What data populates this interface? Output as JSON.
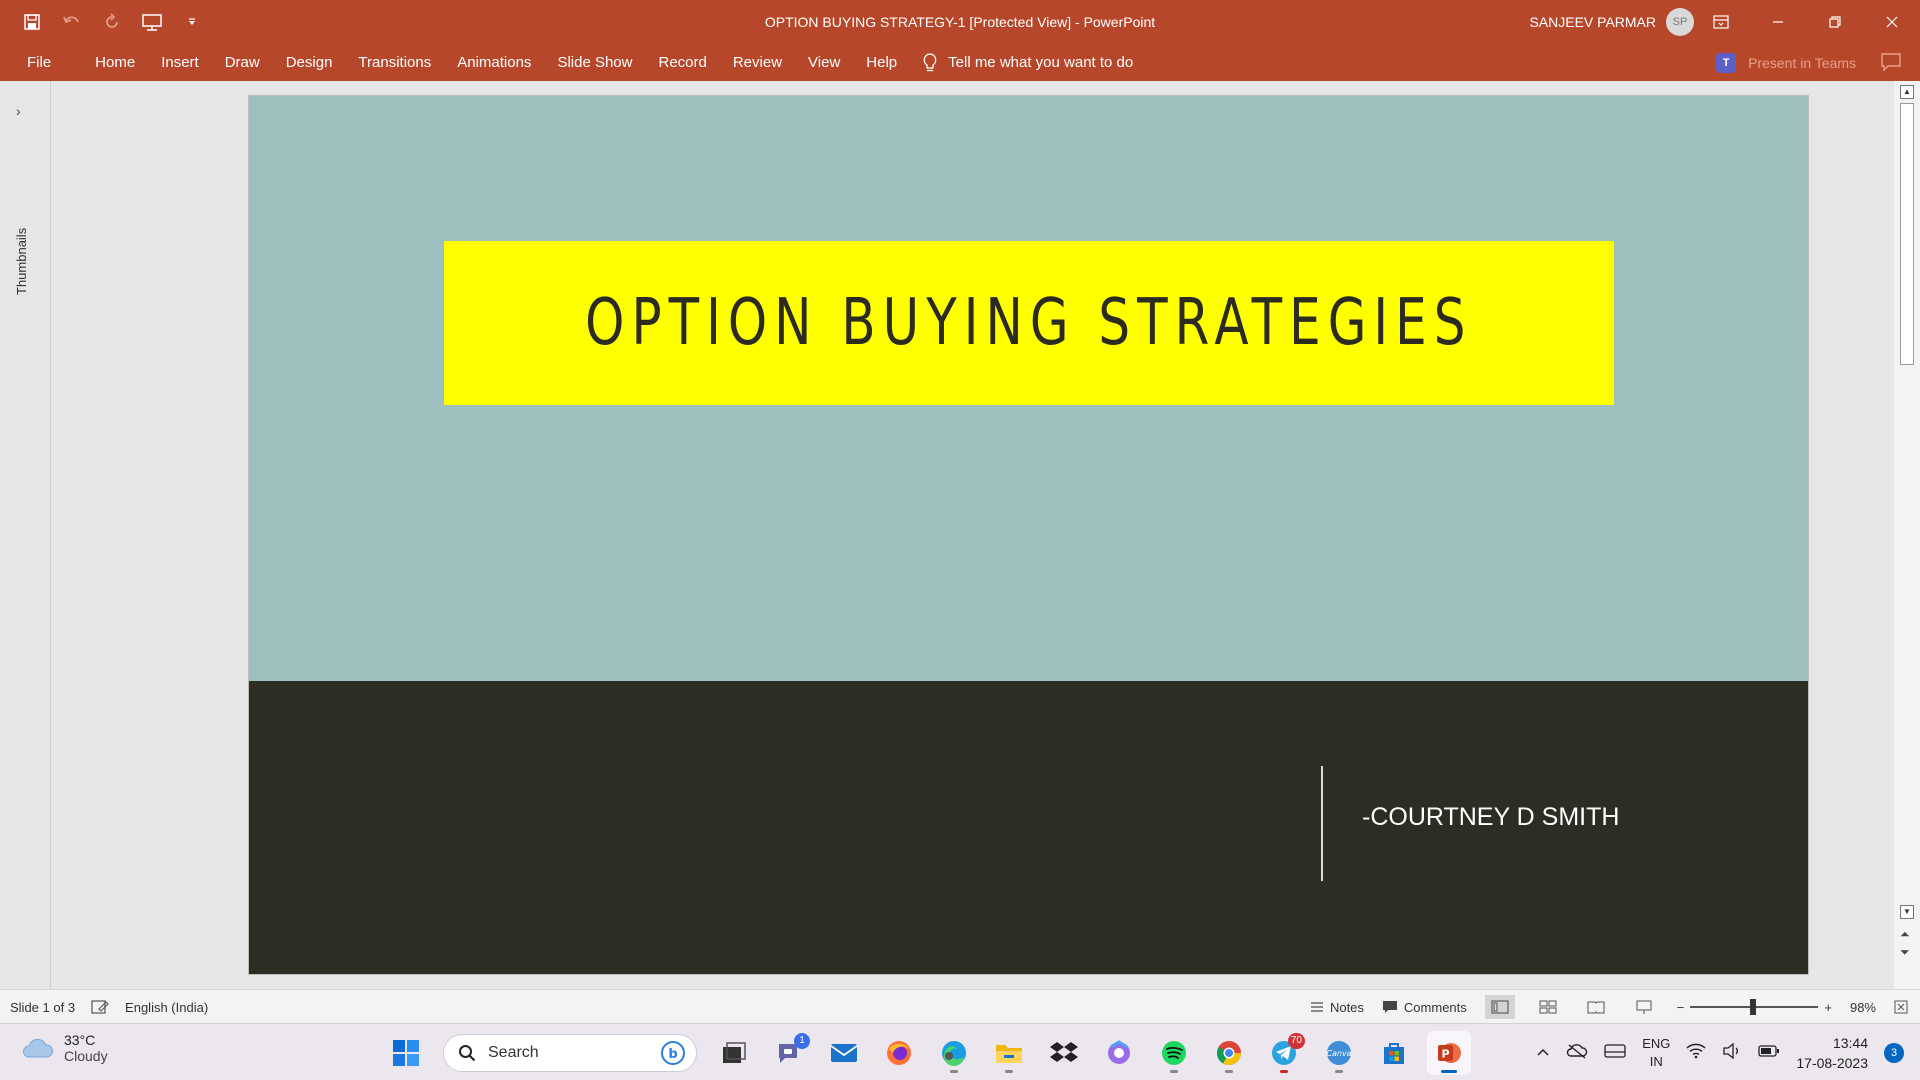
{
  "window": {
    "title": "OPTION BUYING STRATEGY-1 [Protected View]  -  PowerPoint",
    "user_name": "SANJEEV PARMAR",
    "user_initials": "SP"
  },
  "menu": {
    "items": [
      "File",
      "Home",
      "Insert",
      "Draw",
      "Design",
      "Transitions",
      "Animations",
      "Slide Show",
      "Record",
      "Review",
      "View",
      "Help"
    ],
    "tell_me": "Tell me what you want to do",
    "present_in_teams": "Present in Teams"
  },
  "sidebar": {
    "label": "Thumbnails"
  },
  "slide": {
    "title": "OPTION BUYING STRATEGIES",
    "author": "-COURTNEY D SMITH",
    "colors": {
      "background": "#9dbfbd",
      "title_box": "#ffff00",
      "band": "#2e2d24"
    }
  },
  "status": {
    "slide_indicator": "Slide 1 of 3",
    "language": "English (India)",
    "notes": "Notes",
    "comments": "Comments",
    "zoom": "98%"
  },
  "taskbar": {
    "weather_temp": "33°C",
    "weather_desc": "Cloudy",
    "search_placeholder": "Search",
    "teams_badge": "1",
    "telegram_badge": "70",
    "lang_line1": "ENG",
    "lang_line2": "IN",
    "time": "13:44",
    "date": "17-08-2023",
    "notification_count": "3"
  }
}
